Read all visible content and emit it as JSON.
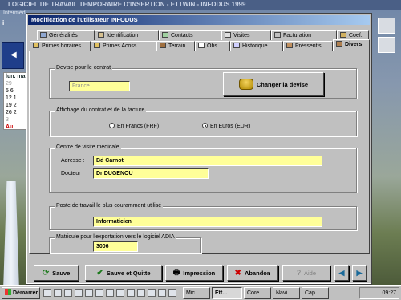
{
  "background": {
    "title": "LOGICIEL DE TRAVAIL TEMPORAIRE D'INSERTION - ETTWIN - INFODUS 1999",
    "menu": "Intermédi",
    "left_title": "i",
    "calendar": {
      "header": "lun.  ma",
      "rows": [
        "29",
        "5  6",
        "12  1",
        "19  2",
        "26  2",
        "3"
      ],
      "circled": "Au"
    }
  },
  "dialog": {
    "title": "Modification de l'utilisateur INFODUS",
    "tabs_row1": [
      {
        "label": "Généralités",
        "icon": "list-icon"
      },
      {
        "label": "Identification",
        "icon": "id-card-icon"
      },
      {
        "label": "Contacts",
        "icon": "contacts-icon"
      },
      {
        "label": "Visites",
        "icon": "visits-icon"
      },
      {
        "label": "Facturation",
        "icon": "invoice-icon"
      },
      {
        "label": "Coef.",
        "icon": "coef-icon"
      }
    ],
    "tabs_row2": [
      {
        "label": "Primes horaires",
        "icon": "clock-icon"
      },
      {
        "label": "Primes Acoss",
        "icon": "bonus-icon"
      },
      {
        "label": "Terrain",
        "icon": "terrain-icon"
      },
      {
        "label": "Obs.",
        "icon": "observation-icon"
      },
      {
        "label": "Historique",
        "icon": "history-icon"
      },
      {
        "label": "Préssentis",
        "icon": "preselection-icon"
      },
      {
        "label": "Divers",
        "icon": "misc-icon"
      }
    ],
    "devise": {
      "group_label": "Devise pour le contrat",
      "value": "France",
      "button": "Changer la devise"
    },
    "affichage": {
      "group_label": "Affichage du contrat et de la facture",
      "option_frf": "En Francs (FRF)",
      "option_eur": "En Euros (EUR)",
      "selected": "eur"
    },
    "visite": {
      "group_label": "Centre de visite médicale",
      "adresse_label": "Adresse :",
      "adresse_value": "Bd Carnot",
      "docteur_label": "Docteur :",
      "docteur_value": "Dr DUGENOU"
    },
    "poste": {
      "group_label": "Poste de travail le plus couramment utilisé",
      "value": "Informaticien"
    },
    "matricule": {
      "group_label": "Matricule pour l'exportation vers le logiciel ADIA",
      "value": "3006"
    },
    "buttons": {
      "save": "Sauve",
      "save_quit": "Sauve et Quitte",
      "print": "Impression",
      "abandon": "Abandon",
      "help": "Aide"
    }
  },
  "taskbar": {
    "start": "Démarrer",
    "tasks": [
      {
        "label": "Mic..."
      },
      {
        "label": "Ett..."
      },
      {
        "label": "Core..."
      },
      {
        "label": "Navi..."
      },
      {
        "label": "Cap..."
      }
    ],
    "clock": "09:27"
  },
  "colors": {
    "field_yellow": "#ffff99",
    "title_blue": "#0a246a",
    "button_face": "#c0c0c0"
  }
}
